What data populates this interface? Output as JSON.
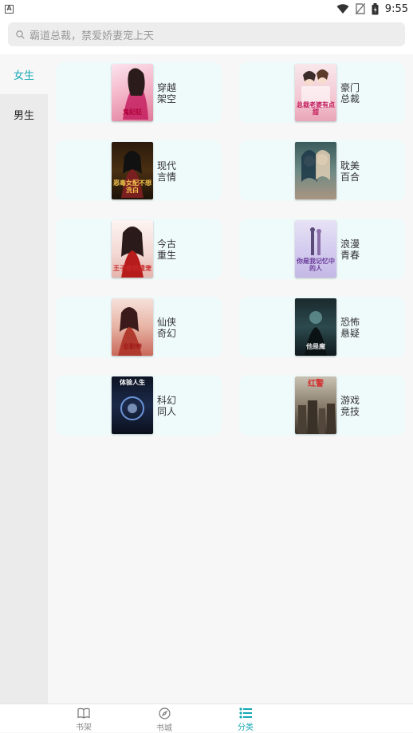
{
  "status_bar": {
    "time": "9:55"
  },
  "search": {
    "placeholder": "霸道总裁，禁爱娇妻宠上天"
  },
  "sidebar": {
    "tabs": [
      {
        "label": "女生",
        "active": true
      },
      {
        "label": "男生",
        "active": false
      }
    ]
  },
  "categories": [
    {
      "line1": "穿越",
      "line2": "架空",
      "cover_text": "鬼妃狂"
    },
    {
      "line1": "豪门",
      "line2": "总裁",
      "cover_text": "总裁老婆有点甜"
    },
    {
      "line1": "现代",
      "line2": "言情",
      "cover_text": "恶毒女配不想洗白"
    },
    {
      "line1": "耽美",
      "line2": "百合",
      "cover_text": ""
    },
    {
      "line1": "今古",
      "line2": "重生",
      "cover_text": "王子绝世盛宠"
    },
    {
      "line1": "浪漫",
      "line2": "青春",
      "cover_text": "你是我记忆中的人"
    },
    {
      "line1": "仙侠",
      "line2": "奇幻",
      "cover_text": "全职帝"
    },
    {
      "line1": "恐怖",
      "line2": "悬疑",
      "cover_text": "他是魔"
    },
    {
      "line1": "科幻",
      "line2": "同人",
      "cover_text": "体验人生"
    },
    {
      "line1": "游戏",
      "line2": "竞技",
      "cover_text": "红警"
    }
  ],
  "bottom_nav": [
    {
      "label": "书架",
      "icon": "book-icon",
      "active": false
    },
    {
      "label": "书城",
      "icon": "compass-icon",
      "active": false
    },
    {
      "label": "分类",
      "icon": "list-icon",
      "active": true
    }
  ],
  "colors": {
    "accent": "#17a8b5",
    "card_bg": "#effafb",
    "sidebar_bg": "#ebebeb"
  }
}
